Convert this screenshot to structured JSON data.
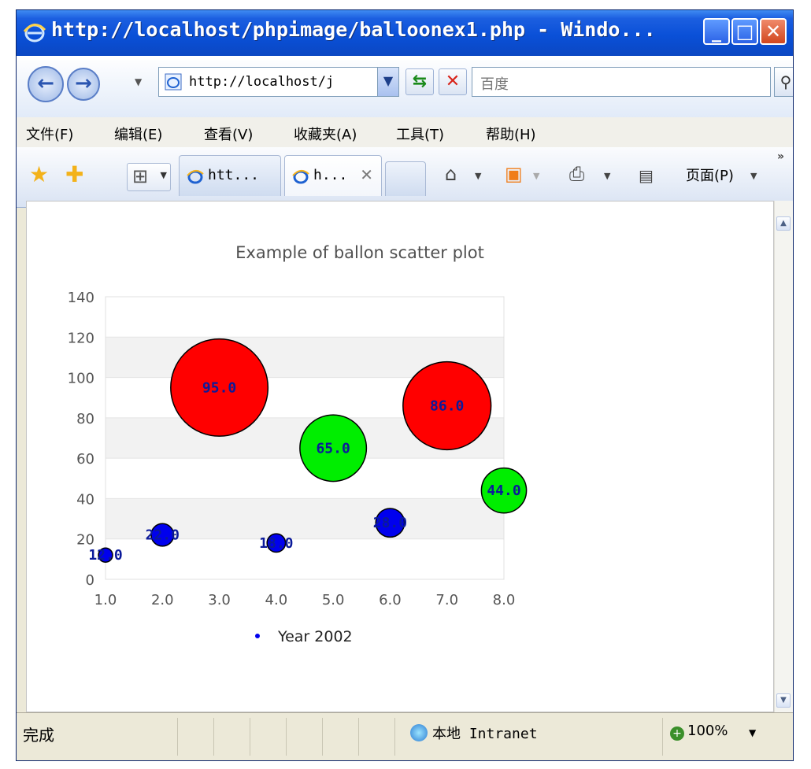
{
  "window": {
    "title": "http://localhost/phpimage/balloonex1.php - Windo...",
    "minimize_glyph": "_",
    "maximize_glyph": "□",
    "close_glyph": "✕"
  },
  "address_bar": {
    "url": "http://localhost/j",
    "search_value": "百度"
  },
  "menu": {
    "items": [
      "文件(F)",
      "编辑(E)",
      "查看(V)",
      "收藏夹(A)",
      "工具(T)",
      "帮助(H)"
    ]
  },
  "tabs": [
    {
      "label": "htt..."
    },
    {
      "label": "h..."
    }
  ],
  "command_bar": {
    "page_menu": "页面(P)",
    "more": "»"
  },
  "status_bar": {
    "status": "完成",
    "zone": "本地 Intranet",
    "zoom": "100%"
  },
  "colors": {
    "red": "#ff0000",
    "green": "#00ee00",
    "blue": "#0000ee",
    "label": "#0b1a9a",
    "grid_band": "#f2f2f2"
  },
  "chart_data": {
    "type": "scatter",
    "title": "Example of ballon scatter plot",
    "xlim": [
      1.0,
      8.0
    ],
    "ylim": [
      0,
      140
    ],
    "x_ticks": [
      "1.0",
      "2.0",
      "3.0",
      "4.0",
      "5.0",
      "6.0",
      "7.0",
      "8.0"
    ],
    "y_ticks": [
      "0",
      "20",
      "40",
      "60",
      "80",
      "100",
      "120",
      "140"
    ],
    "grid": true,
    "legend": {
      "placement": "bottom",
      "label": "Year 2002"
    },
    "series": [
      {
        "name": "Year 2002",
        "points": [
          {
            "x": 1,
            "y": 12,
            "size": 12.0,
            "label": "12.0",
            "color": "blue"
          },
          {
            "x": 2,
            "y": 22,
            "size": 22.0,
            "label": "22.0",
            "color": "blue"
          },
          {
            "x": 3,
            "y": 95,
            "size": 95.0,
            "label": "95.0",
            "color": "red"
          },
          {
            "x": 4,
            "y": 18,
            "size": 18.0,
            "label": "18.0",
            "color": "blue"
          },
          {
            "x": 5,
            "y": 65,
            "size": 65.0,
            "label": "65.0",
            "color": "green"
          },
          {
            "x": 6,
            "y": 28,
            "size": 28.0,
            "label": "28.0",
            "color": "blue"
          },
          {
            "x": 7,
            "y": 86,
            "size": 86.0,
            "label": "86.0",
            "color": "red"
          },
          {
            "x": 8,
            "y": 44,
            "size": 44.0,
            "label": "44.0",
            "color": "green"
          }
        ]
      }
    ]
  }
}
